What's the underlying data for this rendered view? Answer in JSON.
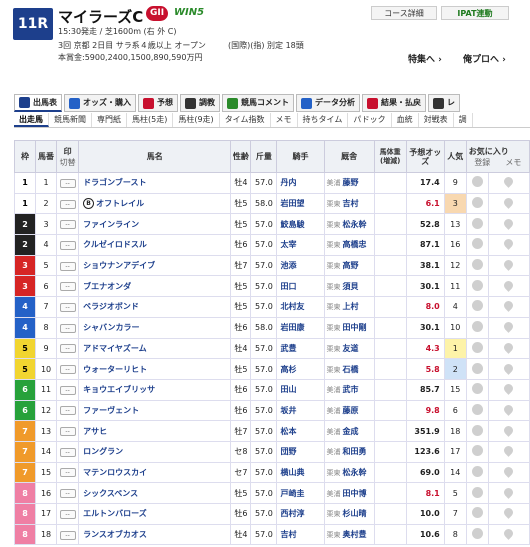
{
  "race": {
    "number": "11R",
    "name": "マイラーズC",
    "grade": "GII",
    "win5": "WIN5",
    "time_distance": "15:30発走 / 芝1600m (右 外 C)",
    "condition": "3回 京都 2日目 サラ系４歳以上 オープン",
    "condition_right": "(国際)(指) 別定 18頭",
    "prize": "本賞金:5900,2400,1500,890,590万円"
  },
  "buttons": {
    "course": "コース詳細",
    "ipat": "IPAT連動"
  },
  "links": {
    "tokusyu": "特集へ ›",
    "oreproa": "俺プロへ ›"
  },
  "tabs": [
    {
      "label": "出馬表",
      "color": "#1d3f8c"
    },
    {
      "label": "オッズ・購入",
      "color": "#2461c7"
    },
    {
      "label": "予想",
      "color": "#c8102e"
    },
    {
      "label": "調教",
      "color": "#333"
    },
    {
      "label": "競馬コメント",
      "color": "#2a8a2a"
    },
    {
      "label": "データ分析",
      "color": "#2461c7"
    },
    {
      "label": "結果・払戻",
      "color": "#c8102e"
    },
    {
      "label": "レ",
      "color": "#333"
    }
  ],
  "subnav": [
    "出走馬",
    "競馬新聞",
    "専門紙",
    "馬柱(5走)",
    "馬柱(9走)",
    "タイム指数",
    "メモ",
    "持ちタイム",
    "パドック",
    "血統",
    "対戦表",
    "調"
  ],
  "columns": {
    "waku": "枠",
    "umaban": "馬番",
    "mark": "印",
    "mark2": "切替",
    "name": "馬名",
    "sex": "性齢",
    "weight": "斤量",
    "jockey": "騎手",
    "trainer": "厩舎",
    "body": "馬体重(増減)",
    "odds": "予想オッズ",
    "ninki": "人気",
    "fav": "お気に入り",
    "fav2": "登録",
    "fav3": "メモ"
  },
  "mark_label": "--",
  "horses": [
    {
      "waku": 1,
      "umaban": 1,
      "name": "ドラゴンブースト",
      "sex": "牡4",
      "weight": "57.0",
      "jockey": "丹内",
      "reg": "美浦",
      "trainer": "藤野",
      "odds": "17.4",
      "ninki": "9"
    },
    {
      "waku": 1,
      "umaban": 2,
      "name": "オフトレイル",
      "sex": "牡5",
      "weight": "58.0",
      "jockey": "岩田望",
      "reg": "栗東",
      "trainer": "吉村",
      "odds": "6.1",
      "ninki": "3",
      "hot": true,
      "k": "3",
      "logo": "B"
    },
    {
      "waku": 2,
      "umaban": 3,
      "name": "ファインライン",
      "sex": "牡5",
      "weight": "57.0",
      "jockey": "鮫島駿",
      "reg": "栗東",
      "trainer": "松永幹",
      "odds": "52.8",
      "ninki": "13"
    },
    {
      "waku": 2,
      "umaban": 4,
      "name": "クルゼイロドスル",
      "sex": "牡6",
      "weight": "57.0",
      "jockey": "太宰",
      "reg": "栗東",
      "trainer": "高橋忠",
      "odds": "87.1",
      "ninki": "16"
    },
    {
      "waku": 3,
      "umaban": 5,
      "name": "ショウナンアデイブ",
      "sex": "牡7",
      "weight": "57.0",
      "jockey": "池添",
      "reg": "栗東",
      "trainer": "高野",
      "odds": "38.1",
      "ninki": "12"
    },
    {
      "waku": 3,
      "umaban": 6,
      "name": "ブエナオンダ",
      "sex": "牡5",
      "weight": "57.0",
      "jockey": "田口",
      "reg": "栗東",
      "trainer": "須貝",
      "odds": "30.1",
      "ninki": "11"
    },
    {
      "waku": 4,
      "umaban": 7,
      "name": "ベラジオボンド",
      "sex": "牡5",
      "weight": "57.0",
      "jockey": "北村友",
      "reg": "栗東",
      "trainer": "上村",
      "odds": "8.0",
      "ninki": "4",
      "hot": true
    },
    {
      "waku": 4,
      "umaban": 8,
      "name": "シャバンカラー",
      "sex": "牡6",
      "weight": "58.0",
      "jockey": "岩田康",
      "reg": "栗東",
      "trainer": "田中剛",
      "odds": "30.1",
      "ninki": "10"
    },
    {
      "waku": 5,
      "umaban": 9,
      "name": "アドマイヤズーム",
      "sex": "牡4",
      "weight": "57.0",
      "jockey": "武豊",
      "reg": "栗東",
      "trainer": "友道",
      "odds": "4.3",
      "ninki": "1",
      "hot": true,
      "k": "1"
    },
    {
      "waku": 5,
      "umaban": 10,
      "name": "ウォーターリヒト",
      "sex": "牡5",
      "weight": "57.0",
      "jockey": "高杉",
      "reg": "栗東",
      "trainer": "石橋",
      "odds": "5.8",
      "ninki": "2",
      "hot": true,
      "k": "2"
    },
    {
      "waku": 6,
      "umaban": 11,
      "name": "キョウエイブリッサ",
      "sex": "牡6",
      "weight": "57.0",
      "jockey": "田山",
      "reg": "美浦",
      "trainer": "武市",
      "odds": "85.7",
      "ninki": "15"
    },
    {
      "waku": 6,
      "umaban": 12,
      "name": "ファーヴェント",
      "sex": "牡6",
      "weight": "57.0",
      "jockey": "坂井",
      "reg": "美浦",
      "trainer": "藤原",
      "odds": "9.8",
      "ninki": "6",
      "hot": true
    },
    {
      "waku": 7,
      "umaban": 13,
      "name": "アサヒ",
      "sex": "牡7",
      "weight": "57.0",
      "jockey": "松本",
      "reg": "美浦",
      "trainer": "金成",
      "odds": "351.9",
      "ninki": "18"
    },
    {
      "waku": 7,
      "umaban": 14,
      "name": "ロングラン",
      "sex": "セ8",
      "weight": "57.0",
      "jockey": "団野",
      "reg": "美浦",
      "trainer": "和田勇",
      "odds": "123.6",
      "ninki": "17"
    },
    {
      "waku": 7,
      "umaban": 15,
      "name": "マテンロウスカイ",
      "sex": "セ7",
      "weight": "57.0",
      "jockey": "横山典",
      "reg": "栗東",
      "trainer": "松永幹",
      "odds": "69.0",
      "ninki": "14"
    },
    {
      "waku": 8,
      "umaban": 16,
      "name": "シックスペンス",
      "sex": "牡5",
      "weight": "57.0",
      "jockey": "戸崎圭",
      "reg": "美浦",
      "trainer": "田中博",
      "odds": "8.1",
      "ninki": "5",
      "hot": true
    },
    {
      "waku": 8,
      "umaban": 17,
      "name": "エルトンバローズ",
      "sex": "牡6",
      "weight": "57.0",
      "jockey": "西村淳",
      "reg": "栗東",
      "trainer": "杉山晴",
      "odds": "10.0",
      "ninki": "7"
    },
    {
      "waku": 8,
      "umaban": 18,
      "name": "ランスオブカオス",
      "sex": "牡4",
      "weight": "57.0",
      "jockey": "吉村",
      "reg": "栗東",
      "trainer": "奥村豊",
      "odds": "10.6",
      "ninki": "8"
    }
  ]
}
